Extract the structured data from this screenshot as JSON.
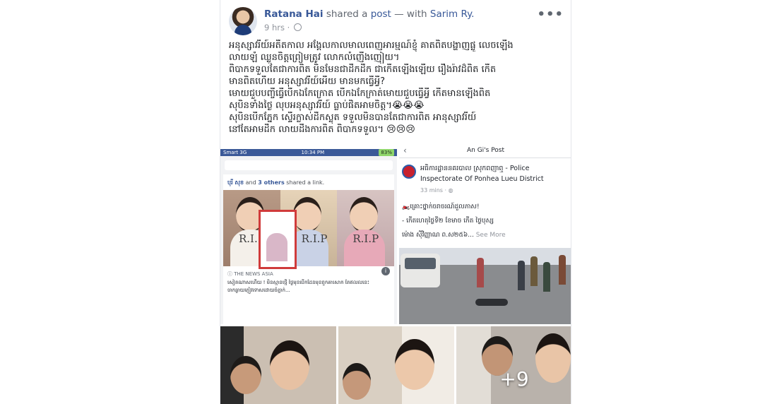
{
  "header": {
    "author": "Ratana Hai",
    "shared": "shared a",
    "post_word": "post",
    "with_word": "— with",
    "tagged": "Sarim Ry.",
    "time": "9 hrs ·",
    "more": "•••"
  },
  "post_text": [
    "អនុស្សាវរីយ៍អតីតកាល អង្គែលកាលមាលពេញអារម្មណ៍ខ្ញុំ គាតពិតបង្ហាញផ្លូ លេចឡើង",
    "លាយឡំ ឈ្លួនចិត្តព្រៀមត្រូវ លោកលំញើងញៀយ។",
    "ពិបាកទទួលតែជាការពិត មិនមែនជាដឹកដីក ជាកើតឡើងឡើយ រឿងរ៉ាវដ៏ពិត កើត",
    "មានពិតហើយ អនុស្សាវរីយ៍អើយ មានមកធ្វើអ្វី?",
    "មោយជួបបញ្ចីធ្វើបើកឯកែក្រោត បើកឯកែក្រាត់មោយជួបធ្វើអ្វី កើតមានឡើងពិត",
    "សុបិនទាំងថ្ងៃ លុបអនុស្សាវរីយ៍ ធ្លាប់ផិតអាមចិត្ត។😭😭😭",
    "សុបិនបើកភ្នែក ស្ទើរក្លាស់ដឹកស្លុត ទទួលមិនបានតែជាការពិត អានុស្សាវរីយ៍",
    "នៅតែអាមដឹក លាយដឹងការពិត ពិបាកទទួល។ 😢😢😢"
  ],
  "left_shot": {
    "carrier": "Smart 3G",
    "time": "10:34 PM",
    "battery": "83%",
    "shared_line_name": "បុរី សុខ",
    "shared_line_and": " and ",
    "shared_line_others": "3 others",
    "shared_line_rest": " shared a link.",
    "rip_labels": [
      "R.I.",
      "R.I.P",
      "R.I.P"
    ],
    "source": "ⓘ THE NEWS ASIA",
    "caption": [
      "សៀតណាសហើយ ! មិនស្មានថ្មើ ថ្ងៃមុនបើកដែនមុខពួកគាសោក តែឥលលនេះ",
      "ចាកឆ្ងាយភ្ញៀវទោសដោយចំភ្នាក់..."
    ],
    "info": "i"
  },
  "right_shot": {
    "back": "‹",
    "title": "An Gi's Post",
    "page_name_lines": [
      "អធិការដ្ឋាននគរបាល ស្រុកពញាឮ - Police",
      "Inspectorate Of Ponhea Lueu District"
    ],
    "mins": "33 mins · ◍",
    "lines": [
      "🏍️គ្រោះថ្នាក់ចរាចរណ៍ដួលភាស!",
      "- កើតហេតុថ្ងៃទី២ ខែមាច កើត ថ្ងៃបុស្ស",
      "ម៉ោង ស៊ីវិញ្ញាណ ព.ស២៥៦..."
    ],
    "see_more": "See More"
  },
  "thumbs": {
    "more_count": "+9"
  },
  "colors": {
    "link": "#385898",
    "meta": "#90949c",
    "text": "#1c1e21"
  }
}
